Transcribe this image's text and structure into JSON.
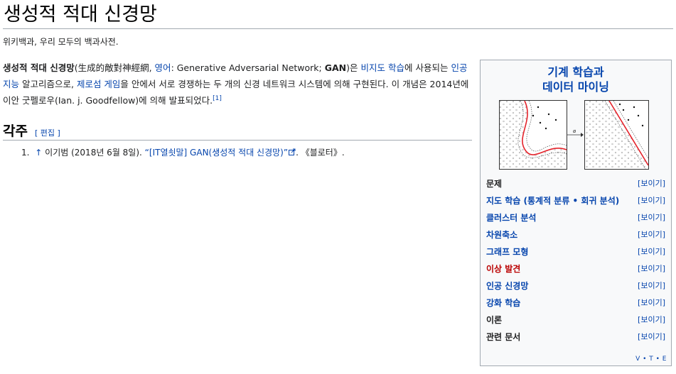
{
  "page": {
    "title": "생성적 적대 신경망",
    "tagline": "위키백과, 우리 모두의 백과사전."
  },
  "lead": {
    "term": "생성적 적대 신경망",
    "hanja": "(生成的敵對神經網, ",
    "lang_link": "영어",
    "english": ": Generative Adversarial Network; ",
    "abbr": "GAN",
    "p1": ")은 ",
    "link_unsupervised": "비지도 학습",
    "p2": "에 사용되는 ",
    "link_ai": "인공지능",
    "p3": " 알고리즘으로, ",
    "link_zerosum": "제로섬 게임",
    "p4": "을 안에서 서로 경쟁하는 두 개의 신경 네트워크 시스템에 의해 구현된다. 이 개념은 2014년에 이안 굿펠로우(Ian. j. Goodfellow)에 의해 발표되었다.",
    "ref_marker": "[1]"
  },
  "references": {
    "heading": "각주",
    "edit": "[ 편집 ]",
    "items": [
      {
        "number": "1.",
        "arrow": "↑",
        "author": "이기범 (2018년 6월 8일). ",
        "link": "“[IT열쇳말] GAN(생성적 적대 신경망)”",
        "ext_icon": "external-link-icon",
        "tail": ". 《블로터》."
      }
    ]
  },
  "infobox": {
    "title_line1": "기계 학습과",
    "title_line2": "데이터 마이닝",
    "arrow_dot": "ø",
    "items": [
      {
        "label": "문제",
        "show": "[보이기]",
        "style": "plain"
      },
      {
        "label": "지도 학습 (통계적 분류 • 회귀 분석)",
        "show": "[보이기]",
        "style": "blue"
      },
      {
        "label": "클러스터 분석",
        "show": "[보이기]",
        "style": "blue"
      },
      {
        "label": "차원축소",
        "show": "[보이기]",
        "style": "blue"
      },
      {
        "label": "그래프 모형",
        "show": "[보이기]",
        "style": "blue"
      },
      {
        "label": "이상 발견",
        "show": "[보이기]",
        "style": "red"
      },
      {
        "label": "인공 신경망",
        "show": "[보이기]",
        "style": "blue"
      },
      {
        "label": "강화 학습",
        "show": "[보이기]",
        "style": "blue"
      },
      {
        "label": "이론",
        "show": "[보이기]",
        "style": "plain"
      },
      {
        "label": "관련 문서",
        "show": "[보이기]",
        "style": "plain"
      }
    ],
    "vte": "V • T • E"
  },
  "colors": {
    "link": "#0645ad",
    "redlink": "#ba0000",
    "rule": "#a2a9b1",
    "infobox_bg": "#f8f9fa",
    "curve_red": "#e4222a"
  }
}
